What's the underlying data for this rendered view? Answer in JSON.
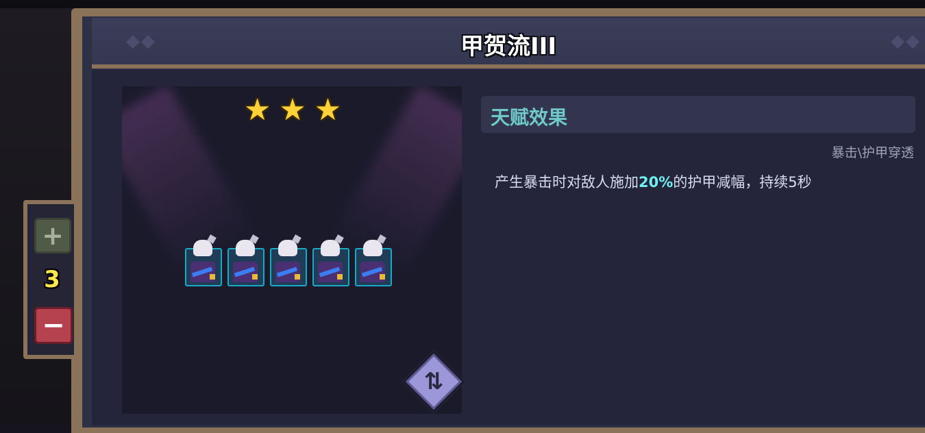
{
  "title": "甲贺流III",
  "team": {
    "star_count": 3,
    "stars": [
      "★",
      "★",
      "★"
    ],
    "unit_count": 5
  },
  "talent": {
    "header": "天赋效果",
    "tags": "暴击\\护甲穿透",
    "desc_before": "产生暴击时对敌人施加",
    "desc_highlight": "20%",
    "desc_after": "的护甲减幅，持续5秒"
  },
  "controls": {
    "plus_label": "+",
    "count": "3",
    "minus_label": "−"
  },
  "colors": {
    "frame": "#8a7358",
    "highlight": "#6ff0f0",
    "talent_header": "#6fc9c9",
    "count": "#ffe74a",
    "minus_button": "#b7424f"
  },
  "icons": {
    "swap": "swap-arrows-icon",
    "star": "star-icon",
    "unit": "ninja-unit-icon"
  }
}
